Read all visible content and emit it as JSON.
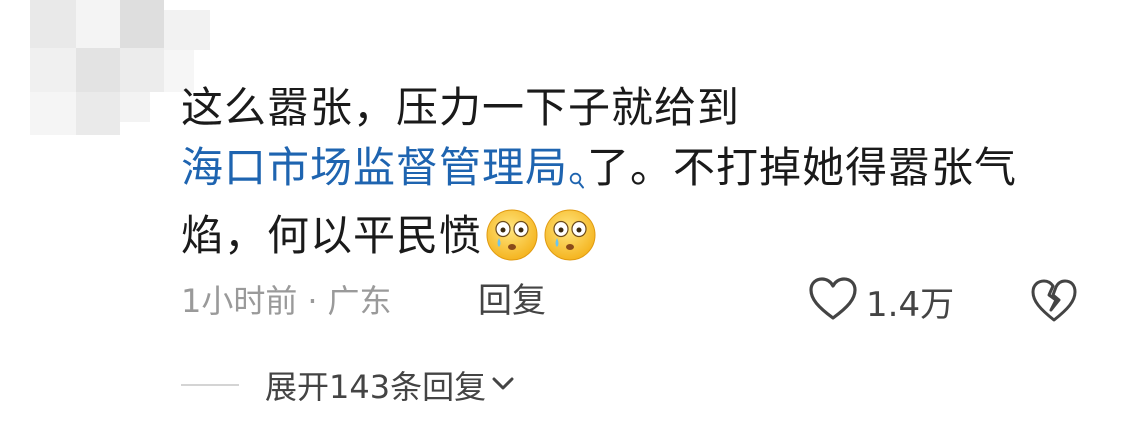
{
  "comment": {
    "line1": "这么嚣张，压力一下子就给到",
    "link_text": "海口市场监督管理局",
    "link_icon": "search-icon",
    "line2_rest": "了。不打掉她得嚣张气",
    "line3": "焰，何以平民愤",
    "emoji": [
      "crying-face-emoji",
      "crying-face-emoji"
    ],
    "link_color": "#1e64b0"
  },
  "meta": {
    "time": "1小时前",
    "separator": "·",
    "location": "广东",
    "reply_label": "回复"
  },
  "like": {
    "icon": "heart-icon",
    "count": "1.4万"
  },
  "dislike": {
    "icon": "broken-heart-icon"
  },
  "expand": {
    "label": "展开143条回复",
    "icon": "chevron-down-icon"
  }
}
